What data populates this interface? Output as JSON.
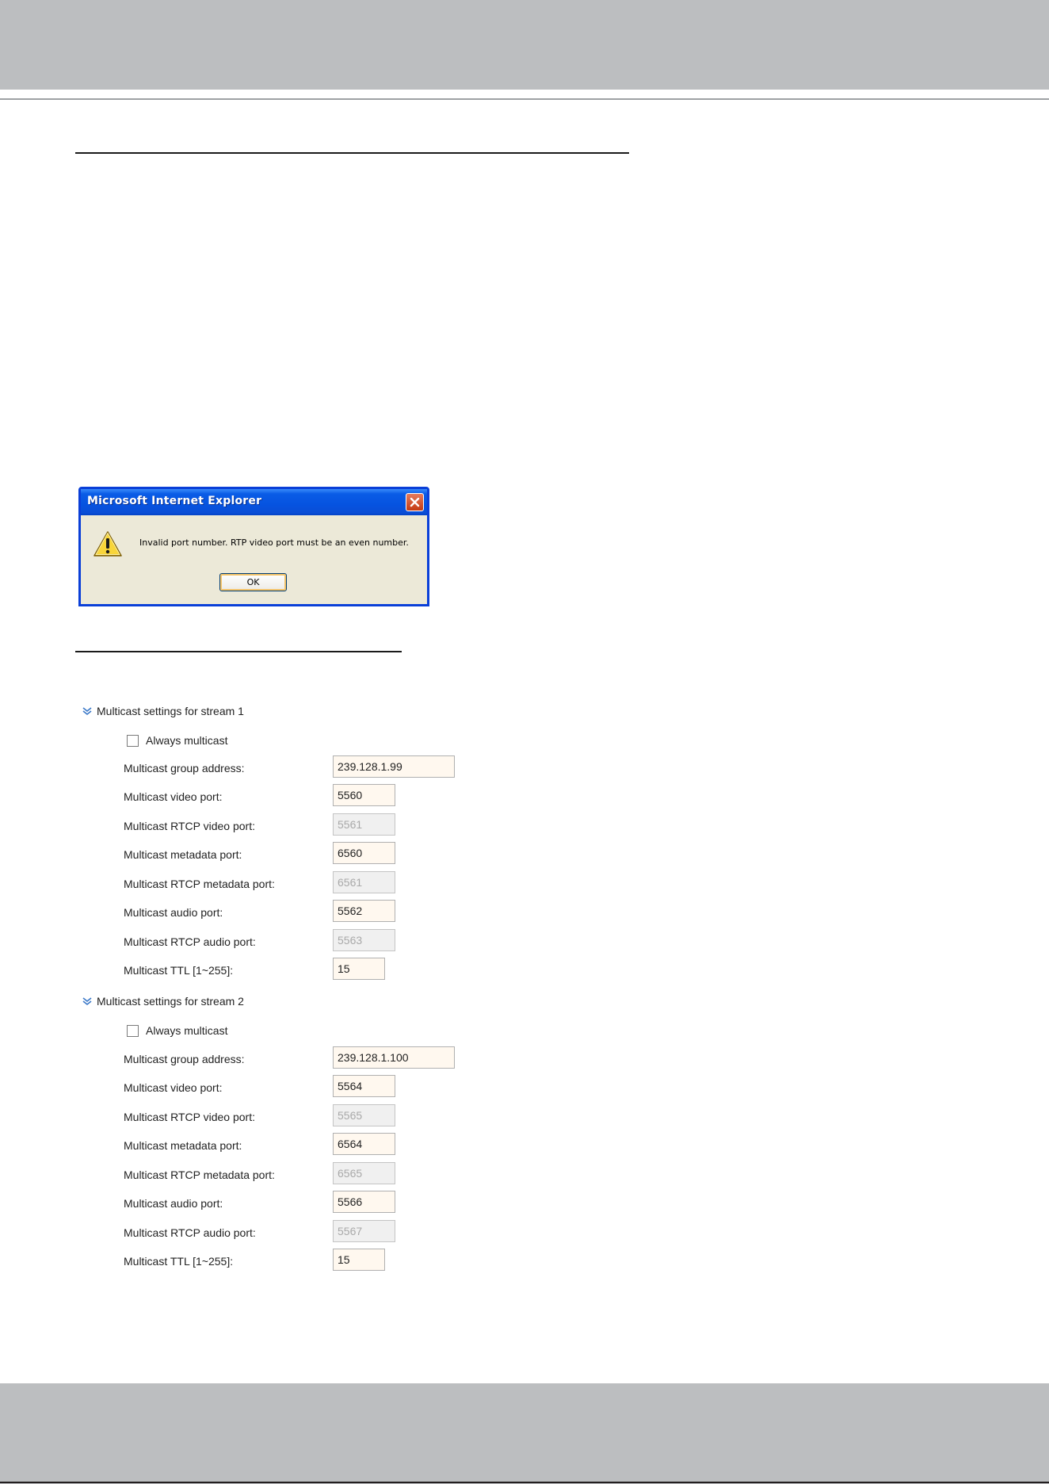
{
  "dialog": {
    "title": "Microsoft Internet Explorer",
    "message": "Invalid port number. RTP video port must be an even number.",
    "ok_label": "OK"
  },
  "streams": [
    {
      "title": "Multicast settings for stream 1",
      "always_multicast_label": "Always multicast",
      "always_multicast_checked": false,
      "fields": [
        {
          "label": "Multicast group address:",
          "value": "239.128.1.99",
          "enabled": true
        },
        {
          "label": "Multicast video port:",
          "value": "5560",
          "enabled": true
        },
        {
          "label": "Multicast RTCP video port:",
          "value": "5561",
          "enabled": false
        },
        {
          "label": "Multicast metadata port:",
          "value": "6560",
          "enabled": true
        },
        {
          "label": "Multicast RTCP metadata port:",
          "value": "6561",
          "enabled": false
        },
        {
          "label": "Multicast audio port:",
          "value": "5562",
          "enabled": true
        },
        {
          "label": "Multicast RTCP audio port:",
          "value": "5563",
          "enabled": false
        },
        {
          "label": "Multicast TTL [1~255]:",
          "value": "15",
          "enabled": true
        }
      ]
    },
    {
      "title": "Multicast settings for stream 2",
      "always_multicast_label": "Always multicast",
      "always_multicast_checked": false,
      "fields": [
        {
          "label": "Multicast group address:",
          "value": "239.128.1.100",
          "enabled": true
        },
        {
          "label": "Multicast video port:",
          "value": "5564",
          "enabled": true
        },
        {
          "label": "Multicast RTCP video port:",
          "value": "5565",
          "enabled": false
        },
        {
          "label": "Multicast metadata port:",
          "value": "6564",
          "enabled": true
        },
        {
          "label": "Multicast RTCP metadata port:",
          "value": "6565",
          "enabled": false
        },
        {
          "label": "Multicast audio port:",
          "value": "5566",
          "enabled": true
        },
        {
          "label": "Multicast RTCP audio port:",
          "value": "5567",
          "enabled": false
        },
        {
          "label": "Multicast TTL [1~255]:",
          "value": "15",
          "enabled": true
        }
      ]
    }
  ],
  "colors": {
    "header_band": "#bcbec0",
    "dialog_title_bar": "#0653e0",
    "enabled_field_bg": "#fff8ef",
    "disabled_field_bg": "#f0f0f0"
  }
}
